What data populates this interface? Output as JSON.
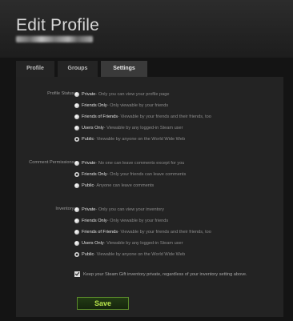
{
  "header": {
    "title": "Edit Profile"
  },
  "tabs": [
    {
      "label": "Profile"
    },
    {
      "label": "Groups"
    },
    {
      "label": "Settings",
      "active": true
    }
  ],
  "sections": {
    "profile_status": {
      "label": "Profile Status:",
      "options": [
        {
          "name": "Private",
          "desc": " - Only you can view your profile page",
          "checked": false
        },
        {
          "name": "Friends Only",
          "desc": " - Only viewable by your friends",
          "checked": false
        },
        {
          "name": "Friends of Friends",
          "desc": " - Viewable by your friends and their friends, too",
          "checked": false
        },
        {
          "name": "Users Only",
          "desc": " - Viewable by any logged-in Steam user",
          "checked": false
        },
        {
          "name": "Public",
          "desc": " - Viewable by anyone on the World Wide Web",
          "checked": true
        }
      ]
    },
    "comment_permissions": {
      "label": "Comment Permissions:",
      "options": [
        {
          "name": "Private",
          "desc": " - No one can leave comments except for you",
          "checked": false
        },
        {
          "name": "Friends Only",
          "desc": " - Only your friends can leave comments",
          "checked": true
        },
        {
          "name": "Public",
          "desc": " - Anyone can leave comments",
          "checked": false
        }
      ]
    },
    "inventory": {
      "label": "Inventory:",
      "options": [
        {
          "name": "Private",
          "desc": " - Only you can view your inventory",
          "checked": false
        },
        {
          "name": "Friends Only",
          "desc": " - Only viewable by your friends",
          "checked": false
        },
        {
          "name": "Friends of Friends",
          "desc": " - Viewable by your friends and their friends, too",
          "checked": false
        },
        {
          "name": "Users Only",
          "desc": " - Viewable by any logged-in Steam user",
          "checked": false
        },
        {
          "name": "Public",
          "desc": " - Viewable by anyone on the World Wide Web",
          "checked": true
        }
      ],
      "gift_checkbox": {
        "label": "Keep your Steam Gift inventory private, regardless of your inventory setting above.",
        "checked": true
      }
    }
  },
  "save_label": "Save",
  "colors": {
    "accent": "#b6e34a",
    "background": "#141414",
    "panel": "#232323"
  }
}
